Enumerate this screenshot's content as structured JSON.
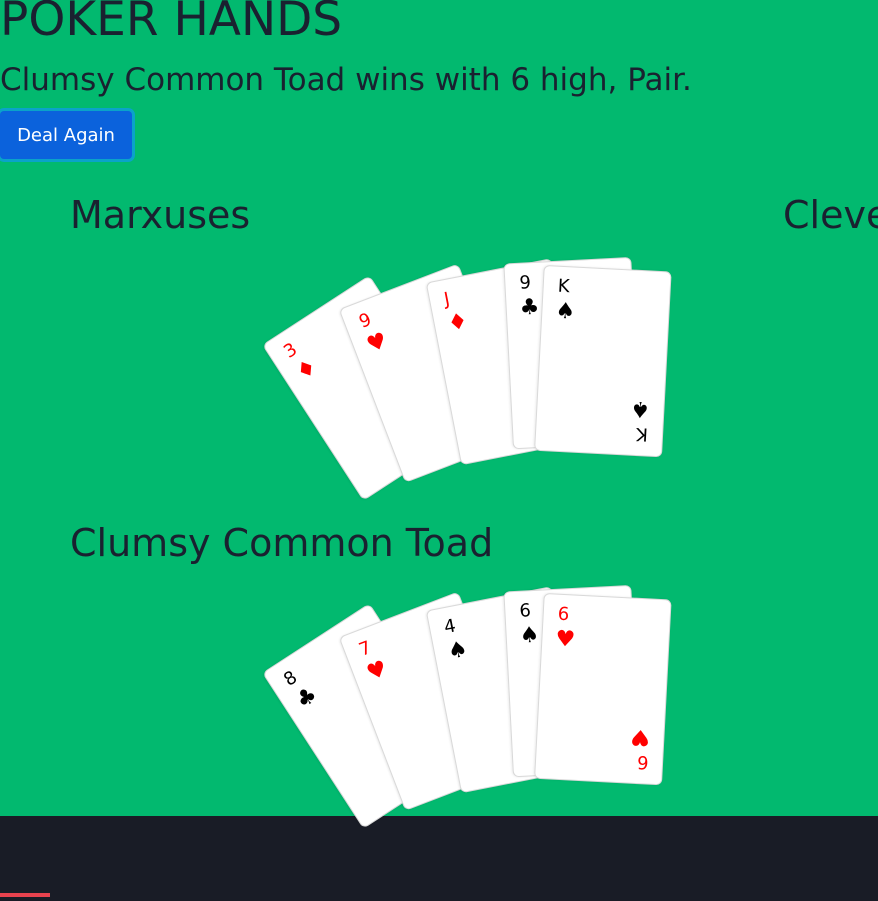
{
  "page": {
    "title": "POKER HANDS",
    "result": "Clumsy Common Toad wins with 6 high, Pair.",
    "deal_label": "Deal Again"
  },
  "players": [
    {
      "name": "Marxuses",
      "cards": [
        {
          "rank": "3",
          "suit": "♦",
          "suit_name": "diamonds",
          "color": "#ff0000"
        },
        {
          "rank": "9",
          "suit": "♥",
          "suit_name": "hearts",
          "color": "#ff0000"
        },
        {
          "rank": "J",
          "suit": "♦",
          "suit_name": "diamonds",
          "color": "#ff0000"
        },
        {
          "rank": "9",
          "suit": "♣",
          "suit_name": "clubs",
          "color": "#000000"
        },
        {
          "rank": "K",
          "suit": "♠",
          "suit_name": "spades",
          "color": "#000000"
        }
      ]
    },
    {
      "name": "Clumsy Common Toad",
      "cards": [
        {
          "rank": "8",
          "suit": "♣",
          "suit_name": "clubs",
          "color": "#000000"
        },
        {
          "rank": "7",
          "suit": "♥",
          "suit_name": "hearts",
          "color": "#ff0000"
        },
        {
          "rank": "4",
          "suit": "♠",
          "suit_name": "spades",
          "color": "#000000"
        },
        {
          "rank": "6",
          "suit": "♠",
          "suit_name": "spades",
          "color": "#000000"
        },
        {
          "rank": "6",
          "suit": "♥",
          "suit_name": "hearts",
          "color": "#ff0000"
        }
      ]
    },
    {
      "name": "Cleve"
    }
  ],
  "colors": {
    "table": "#02b96f",
    "button": "#0b62dc",
    "footer": "#191c26",
    "accent": "#e8424e"
  }
}
